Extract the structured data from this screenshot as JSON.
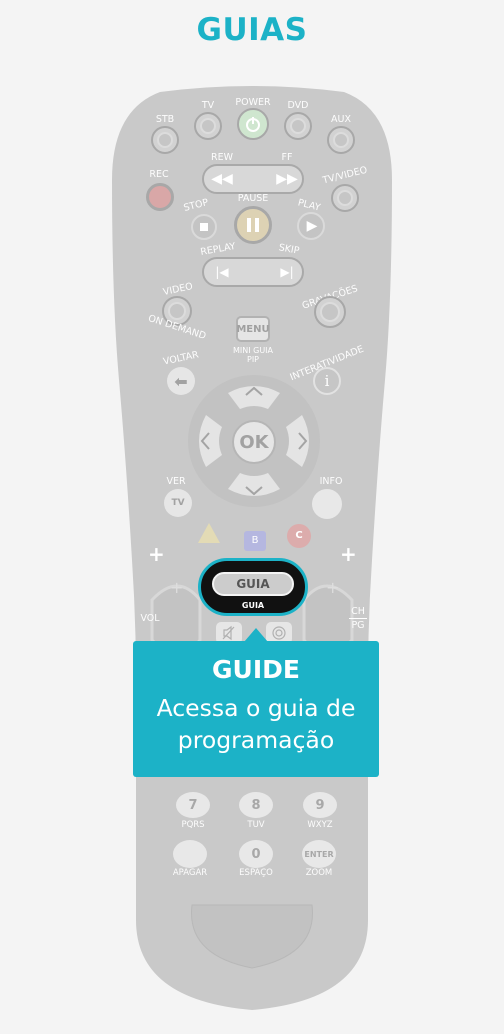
{
  "page": {
    "title": "GUIAS"
  },
  "remote": {
    "top_buttons": [
      "STB",
      "TV",
      "POWER",
      "DVD",
      "AUX"
    ],
    "rew": "REW",
    "ff": "FF",
    "rec": "REC",
    "tvvideo": "TV/VIDEO",
    "stop": "STOP",
    "pause": "PAUSE",
    "play": "PLAY",
    "replay": "REPLAY",
    "skip": "SKIP",
    "video_on_demand_1": "VIDEO",
    "video_on_demand_2": "ON DEMAND",
    "gravacoes": "GRAVAÇÕES",
    "menu": "MENU",
    "mini_guia": "MINI GUIA",
    "pip": "PIP",
    "voltar": "VOLTAR",
    "interatividade": "INTERATIVIDADE",
    "ok": "OK",
    "ver": "VER",
    "tv": "TV",
    "info": "INFO",
    "b": "B",
    "c": "C",
    "plus_left": "+",
    "plus_right": "+",
    "vol": "VOL",
    "ch": "CH",
    "pg": "PG",
    "guia_button": "GUIA",
    "guia_label": "GUIA",
    "numbers": [
      {
        "n": "7",
        "t": "PQRS"
      },
      {
        "n": "8",
        "t": "TUV"
      },
      {
        "n": "9",
        "t": "WXYZ"
      }
    ],
    "apagar": "APAGAR",
    "zero": "0",
    "espaco": "ESPAÇO",
    "enter": "ENTER",
    "zoom": "ZOOM"
  },
  "callout": {
    "heading": "GUIDE",
    "text_line1": "Acessa o guia de",
    "text_line2": "programação"
  },
  "colors": {
    "accent": "#1cb2c7",
    "remote_body": "#c9c9c9"
  }
}
